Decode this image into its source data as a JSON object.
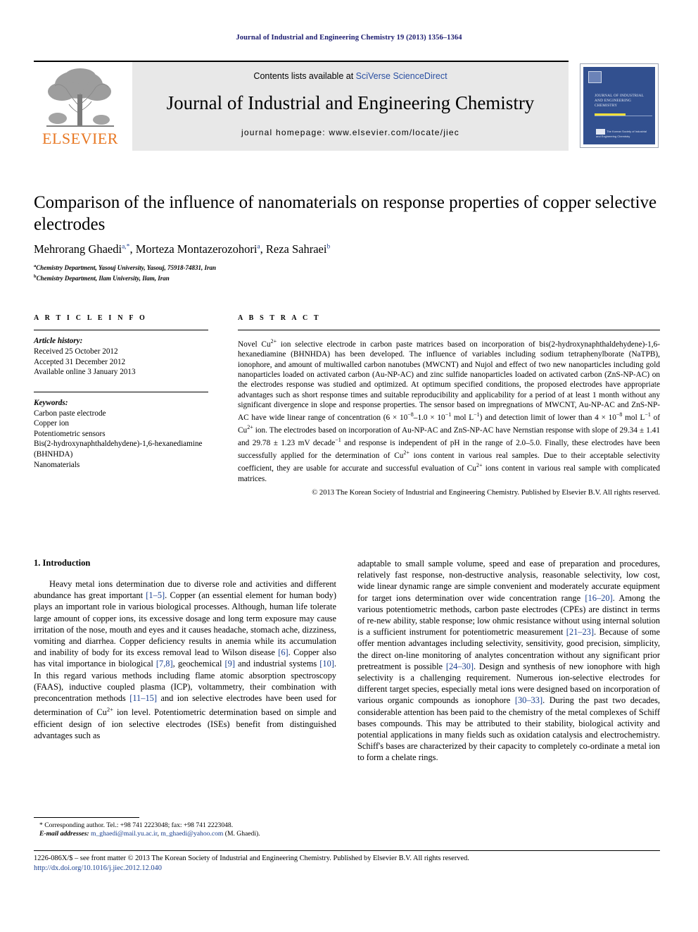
{
  "running_head": "Journal of Industrial and Engineering Chemistry 19 (2013) 1356–1364",
  "header": {
    "publisher_name": "ELSEVIER",
    "contents_prefix": "Contents lists available at ",
    "contents_link": "SciVerse ScienceDirect",
    "journal_title": "Journal of Industrial and Engineering Chemistry",
    "homepage": "journal homepage: www.elsevier.com/locate/jiec",
    "cover": {
      "title_lines": "JOURNAL OF INDUSTRIAL AND ENGINEERING CHEMISTRY",
      "footer_text": "The Korean Society of Industrial and Engineering Chemistry"
    }
  },
  "article": {
    "title": "Comparison of the influence of nanomaterials on response properties of copper selective electrodes",
    "authors": "Mehrorang Ghaedi, Morteza Montazerozohori, Reza Sahraei",
    "author_marks": [
      "a,*",
      "a",
      "b"
    ],
    "affiliations": [
      {
        "mark": "a",
        "text": "Chemistry Department, Yasouj University, Yasouj, 75918-74831, Iran"
      },
      {
        "mark": "b",
        "text": "Chemistry Department, Ilam University, Ilam, Iran"
      }
    ]
  },
  "article_info": {
    "heading": "A R T I C L E  I N F O",
    "history_label": "Article history:",
    "history": [
      "Received 25 October 2012",
      "Accepted 31 December 2012",
      "Available online 3 January 2013"
    ],
    "keywords_label": "Keywords:",
    "keywords": [
      "Carbon paste electrode",
      "Copper ion",
      "Potentiometric sensors",
      "Bis(2-hydroxynaphthaldehydene)-1,6-hexanediamine (BHNHDA)",
      "Nanomaterials"
    ]
  },
  "abstract": {
    "heading": "A B S T R A C T",
    "body": "Novel Cu2+ ion selective electrode in carbon paste matrices based on incorporation of bis(2-hydroxynaphthaldehydene)-1,6-hexanediamine (BHNHDA) has been developed. The influence of variables including sodium tetraphenylborate (NaTPB), ionophore, and amount of multiwalled carbon nanotubes (MWCNT) and Nujol and effect of two new nanoparticles including gold nanoparticles loaded on activated carbon (Au-NP-AC) and zinc sulfide nanoparticles loaded on activated carbon (ZnS-NP-AC) on the electrodes response was studied and optimized. At optimum specified conditions, the proposed electrodes have appropriate advantages such as short response times and suitable reproducibility and applicability for a period of at least 1 month without any significant divergence in slope and response properties. The sensor based on impregnations of MWCNT, Au-NP-AC and ZnS-NP-AC have wide linear range of concentration (6 × 10−8–1.0 × 10−1 mol L−1) and detection limit of lower than 4 × 10−8 mol L−1 of Cu2+ ion. The electrodes based on incorporation of Au-NP-AC and ZnS-NP-AC have Nernstian response with slope of 29.34 ± 1.41 and 29.78 ± 1.23 mV decade−1 and response is independent of pH in the range of 2.0–5.0. Finally, these electrodes have been successfully applied for the determination of Cu2+ ions content in various real samples. Due to their acceptable selectivity coefficient, they are usable for accurate and successful evaluation of Cu2+ ions content in various real sample with complicated matrices.",
    "copyright": "© 2013 The Korean Society of Industrial and Engineering Chemistry. Published by Elsevier B.V. All rights reserved."
  },
  "introduction": {
    "heading": "1. Introduction",
    "left_paragraph": "Heavy metal ions determination due to diverse role and activities and different abundance has great important [1–5]. Copper (an essential element for human body) plays an important role in various biological processes. Although, human life tolerate large amount of copper ions, its excessive dosage and long term exposure may cause irritation of the nose, mouth and eyes and it causes headache, stomach ache, dizziness, vomiting and diarrhea. Copper deficiency results in anemia while its accumulation and inability of body for its excess removal lead to Wilson disease [6]. Copper also has vital importance in biological [7,8], geochemical [9] and industrial systems [10]. In this regard various methods including flame atomic absorption spectroscopy (FAAS), inductive coupled plasma (ICP), voltammetry, their combination with preconcentration methods [11–15] and ion selective electrodes have been used for determination of Cu2+ ion level. Potentiometric determination based on simple and efficient design of ion selective electrodes (ISEs) benefit from distinguished advantages such as",
    "right_paragraph": "adaptable to small sample volume, speed and ease of preparation and procedures, relatively fast response, non-destructive analysis, reasonable selectivity, low cost, wide linear dynamic range are simple convenient and moderately accurate equipment for target ions determination over wide concentration range [16–20]. Among the various potentiometric methods, carbon paste electrodes (CPEs) are distinct in terms of re-new ability, stable response; low ohmic resistance without using internal solution is a sufficient instrument for potentiometric measurement [21–23]. Because of some offer mention advantages including selectivity, sensitivity, good precision, simplicity, the direct on-line monitoring of analytes concentration without any significant prior pretreatment is possible [24–30]. Design and synthesis of new ionophore with high selectivity is a challenging requirement. Numerous ion-selective electrodes for different target species, especially metal ions were designed based on incorporation of various organic compounds as ionophore [30–33]. During the past two decades, considerable attention has been paid to the chemistry of the metal complexes of Schiff bases compounds. This may be attributed to their stability, biological activity and potential applications in many fields such as oxidation catalysis and electrochemistry. Schiff's bases are characterized by their capacity to completely co-ordinate a metal ion to form a chelate rings."
  },
  "footnote": {
    "corresponding": "* Corresponding author. Tel.: +98 741 2223048; fax: +98 741 2223048.",
    "email_label": "E-mail addresses:",
    "email1": "m_ghaedi@mail.yu.ac.ir",
    "email_sep": ", ",
    "email2": "m_ghaedi@yahoo.com",
    "email_suffix": " (M. Ghaedi)."
  },
  "footer": {
    "issn_line": "1226-086X/$ – see front matter © 2013 The Korean Society of Industrial and Engineering Chemistry. Published by Elsevier B.V. All rights reserved.",
    "doi": "http://dx.doi.org/10.1016/j.jiec.2012.12.040"
  },
  "colors": {
    "link_blue": "#1a3f8f",
    "elsevier_orange": "#e87722",
    "banner_gray": "#e8e8e8",
    "cover_blue": "#32508f"
  }
}
